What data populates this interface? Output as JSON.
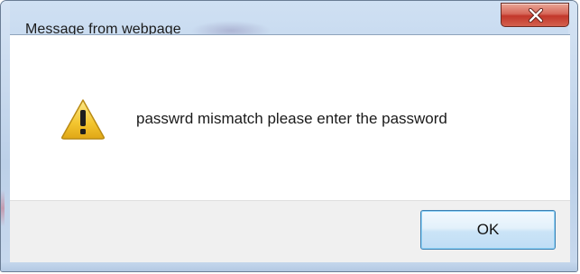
{
  "dialog": {
    "title": "Message from webpage",
    "message": "passwrd mismatch please enter the password",
    "ok_label": "OK",
    "close_glyph": "close-icon",
    "warning_glyph": "warning-icon"
  },
  "colors": {
    "close_button": "#c7463a",
    "warning_fill": "#f2c230",
    "ok_border": "#3c7fb1",
    "frame": "#bdd2ea"
  }
}
